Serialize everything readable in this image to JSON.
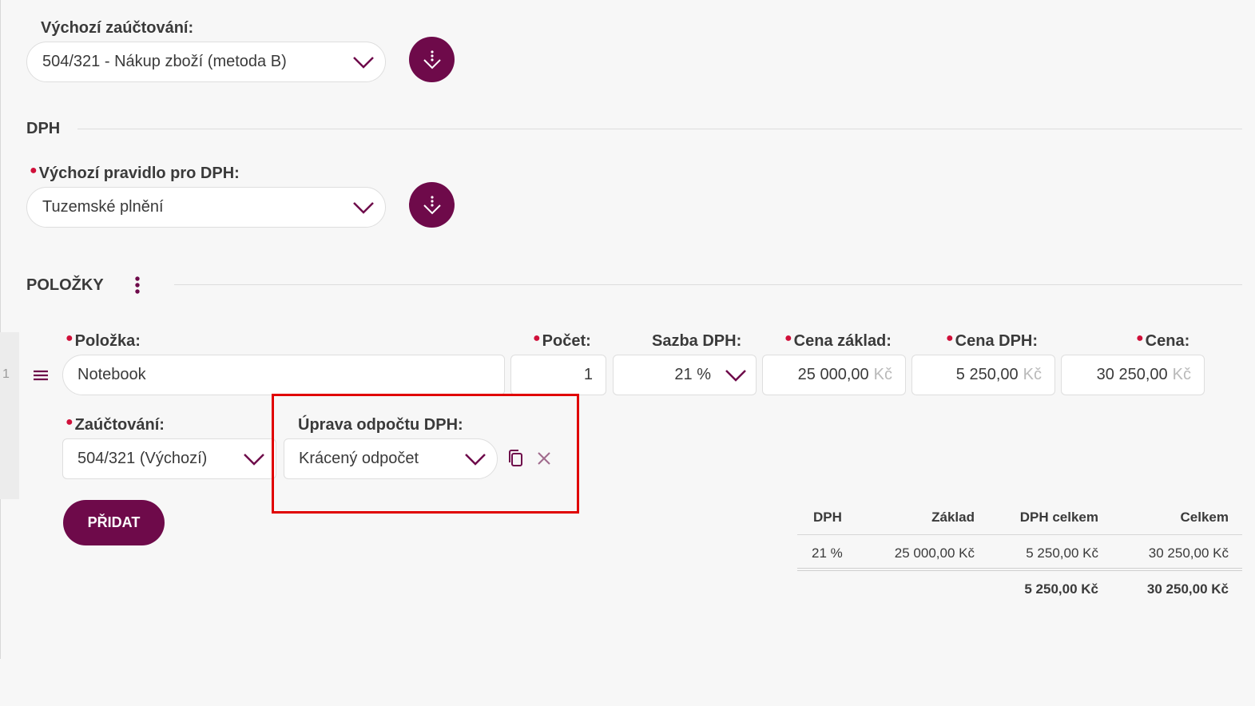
{
  "default_posting": {
    "label": "Výchozí zaúčtování:",
    "value": "504/321 - Nákup zboží (metoda B)"
  },
  "vat_section": {
    "title": "DPH",
    "rule_label": "Výchozí pravidlo pro DPH:",
    "rule_value": "Tuzemské plnění"
  },
  "items_section": {
    "title": "POLOŽKY",
    "row_number": "1",
    "columns": {
      "item": "Položka:",
      "count": "Počet:",
      "vat_rate": "Sazba DPH:",
      "base_price": "Cena základ:",
      "vat_price": "Cena DPH:",
      "price": "Cena:"
    },
    "row": {
      "item": "Notebook",
      "count": "1",
      "vat_rate": "21 %",
      "base_price": "25 000,00",
      "vat_price": "5 250,00",
      "price": "30 250,00",
      "currency": "Kč"
    },
    "posting_label": "Zaúčtování:",
    "posting_value": "504/321 (Výchozí)",
    "vat_adjust_label": "Úprava odpočtu DPH:",
    "vat_adjust_value": "Krácený odpočet",
    "add_button": "PŘIDAT"
  },
  "summary": {
    "headers": [
      "DPH",
      "Základ",
      "DPH celkem",
      "Celkem"
    ],
    "rows": [
      [
        "21 %",
        "25 000,00 Kč",
        "5 250,00 Kč",
        "30 250,00 Kč"
      ]
    ],
    "totals": {
      "vat_total": "5 250,00 Kč",
      "total": "30 250,00 Kč"
    }
  },
  "colors": {
    "accent": "#6e0a4a",
    "required": "#d0103a",
    "highlight": "#e00000"
  }
}
